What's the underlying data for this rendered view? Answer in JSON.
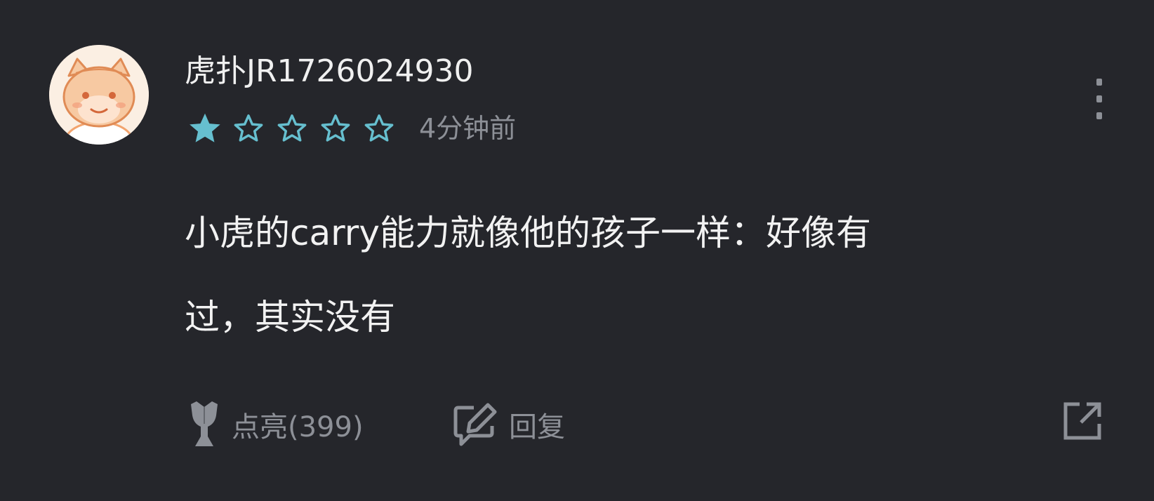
{
  "comment": {
    "username": "虎扑JR1726024930",
    "rating": {
      "value": 1,
      "max": 5
    },
    "time": "4分钟前",
    "content_lines": [
      "小虎的carry能力就像他的孩子一样：好像有",
      "过，其实没有"
    ]
  },
  "actions": {
    "like_label": "点亮(399)",
    "reply_label": "回复"
  },
  "icons": {
    "avatar": "cartoon-animal-avatar",
    "star_filled": "star-filled-icon",
    "star_empty": "star-outline-icon",
    "more": "more-vertical-icon",
    "like": "trophy-icon",
    "reply": "edit-reply-icon",
    "share": "share-icon"
  },
  "colors": {
    "background": "#25262b",
    "text": "#f0f0f0",
    "muted": "#8d9097",
    "star": "#66bfcf",
    "avatar_bg": "#fbefe3",
    "avatar_accent": "#f2a46e"
  }
}
